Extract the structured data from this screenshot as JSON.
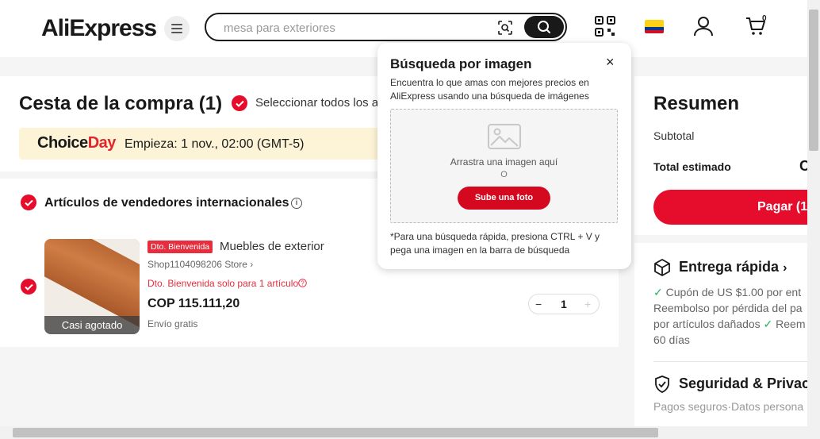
{
  "header": {
    "logo_part1": "Ali",
    "logo_part2": "Express",
    "search_placeholder": "mesa para exteriores",
    "cart_count": "0"
  },
  "cart": {
    "title": "Cesta de la compra (1)",
    "select_all": "Seleccionar todos los ar",
    "choice_logo_1": "Choice",
    "choice_logo_2": "Day",
    "choice_text": "Empieza: 1 nov., 02:00 (GMT-5)",
    "section_title": "Artículos de vendedores internacionales",
    "item": {
      "badge": "Dto. Bienvenida",
      "title": "Muebles de exterior",
      "store": "Shop1104098206 Store ›",
      "promo": "Dto. Bienvenida solo para 1 artículo",
      "price": "COP 115.111,20",
      "shipping": "Envío gratis",
      "soldout": "Casi agotado",
      "qty": "1",
      "qty_minus": "−",
      "qty_plus": "+"
    }
  },
  "summary": {
    "title": "Resumen",
    "subtotal": "Subtotal",
    "total_est": "Total estimado",
    "total_value": "C",
    "pay_label": "Pagar (1",
    "fast_title": "Entrega rápida",
    "fast_line1": "Cupón de US $1.00 por ent",
    "fast_line2": "Reembolso por pérdida del pa",
    "fast_line3": "por artículos dañados",
    "fast_line3b": "Reem",
    "fast_line4": "60 días",
    "secure_title": "Seguridad & Privac",
    "secure_sub": "Pagos seguros·Datos persona"
  },
  "popup": {
    "title": "Búsqueda por imagen",
    "desc": "Encuentra lo que amas con mejores precios en AliExpress usando una búsqueda de imágenes",
    "drop_text": "Arrastra una imagen aquí",
    "or": "O",
    "upload": "Sube una foto",
    "close": "×",
    "note": "*Para una búsqueda rápida, presiona CTRL + V y pega una imagen en la barra de búsqueda"
  },
  "colors": {
    "brand_red": "#e60d2c",
    "success_green": "#2dad63",
    "choice_bg": "#fdf3d7"
  }
}
